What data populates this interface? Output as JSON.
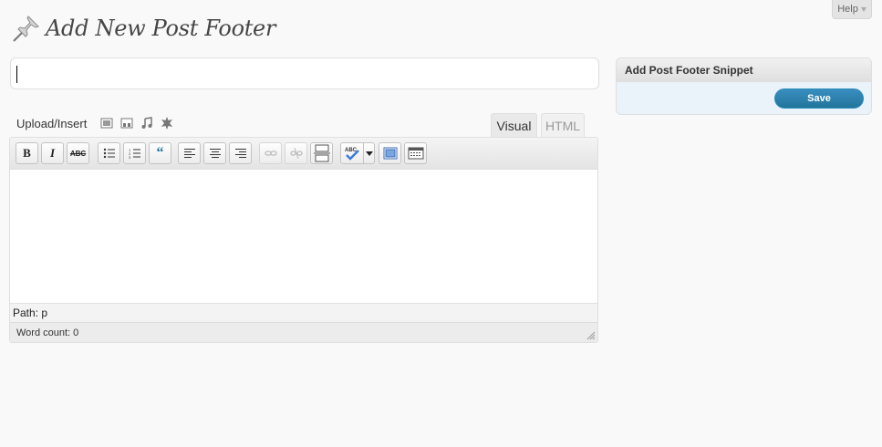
{
  "help_tab": {
    "label": "Help"
  },
  "page": {
    "title": "Add New Post Footer"
  },
  "title_input": {
    "value": ""
  },
  "upload": {
    "label": "Upload/Insert",
    "icons": [
      "image-icon",
      "video-icon",
      "audio-icon",
      "media-icon"
    ]
  },
  "editor": {
    "tabs": [
      {
        "label": "Visual",
        "active": true
      },
      {
        "label": "HTML",
        "active": false
      }
    ],
    "toolbar": [
      "bold",
      "italic",
      "strikethrough",
      "bullet-list",
      "numbered-list",
      "blockquote",
      "align-left",
      "align-center",
      "align-right",
      "insert-link",
      "unlink",
      "insert-more",
      "spellcheck",
      "spellcheck-dropdown",
      "fullscreen",
      "kitchen-sink"
    ],
    "bold_label": "B",
    "italic_label": "I",
    "strike_label": "ABC",
    "spell_label": "ABC",
    "quote_label": "“",
    "path": "Path: p",
    "word_count": "Word count: 0"
  },
  "sidebar": {
    "box_title": "Add Post Footer Snippet",
    "save_label": "Save"
  },
  "colors": {
    "primary_button": "#21759b",
    "box_bg": "#eaf2fa",
    "page_bg": "#f9f9f9"
  }
}
